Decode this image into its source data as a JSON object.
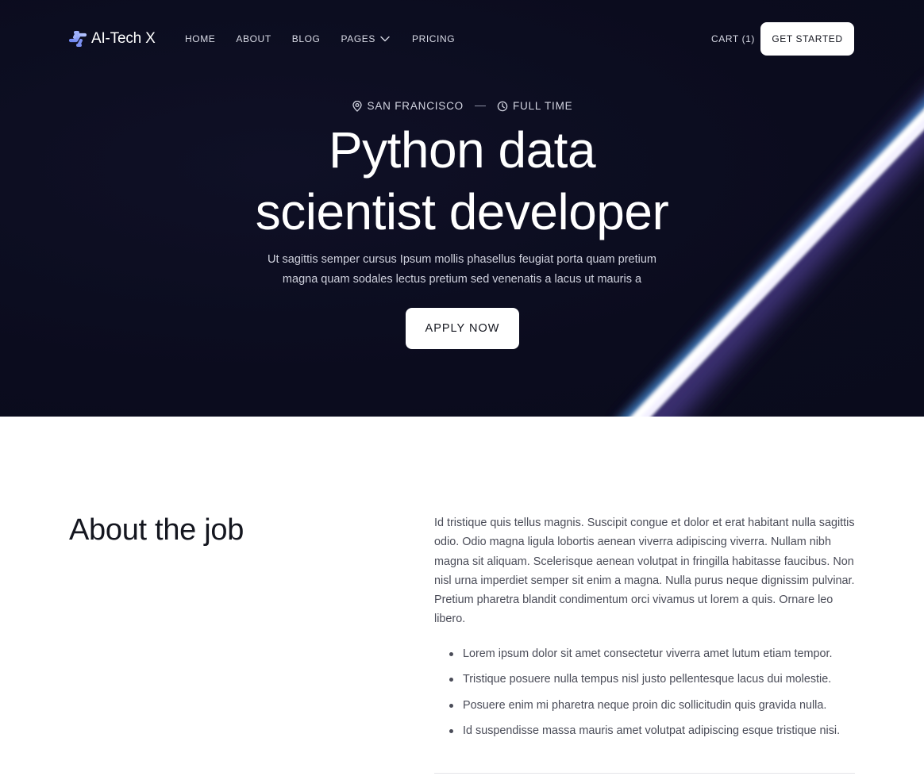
{
  "nav": {
    "logo_text": "AI-Tech X",
    "links": [
      {
        "label": "HOME"
      },
      {
        "label": "ABOUT"
      },
      {
        "label": "BLOG"
      },
      {
        "label": "PAGES",
        "has_dropdown": true
      },
      {
        "label": "PRICING"
      }
    ],
    "cart_label": "CART (1)",
    "cta_label": "GET STARTED"
  },
  "hero": {
    "location": "SAN FRANCISCO",
    "job_type": "FULL TIME",
    "title_line1": "Python data",
    "title_line2": "scientist developer",
    "description": "Ut sagittis semper cursus Ipsum mollis phasellus feugiat porta quam pretium magna quam sodales lectus pretium sed venenatis a lacus ut mauris a",
    "apply_label": "APPLY NOW"
  },
  "about": {
    "title": "About the job",
    "body": "Id tristique quis tellus magnis. Suscipit congue et dolor et erat habitant nulla sagittis odio. Odio magna ligula lobortis aenean viverra adipiscing viverra. Nullam nibh magna sit aliquam. Scelerisque aenean volutpat in fringilla habitasse faucibus. Non nisl urna imperdiet semper sit enim a magna. Nulla purus neque dignissim pulvinar. Pretium pharetra blandit condimentum orci vivamus ut lorem a quis. Ornare leo libero.",
    "bullets": [
      "Lorem ipsum dolor sit amet consectetur viverra amet lutum etiam tempor.",
      "Tristique posuere nulla tempus nisl justo pellentesque lacus dui molestie.",
      "Posuere enim mi pharetra neque proin dic sollicitudin quis gravida nulla.",
      "Id suspendisse massa mauris amet volutpat adipiscing esque tristique nisi."
    ]
  },
  "colors": {
    "hero_bg": "#0b0c1e",
    "logo_accent": "#8aa0f5",
    "text_dark": "#14161f",
    "body_text": "#4a4c58"
  }
}
